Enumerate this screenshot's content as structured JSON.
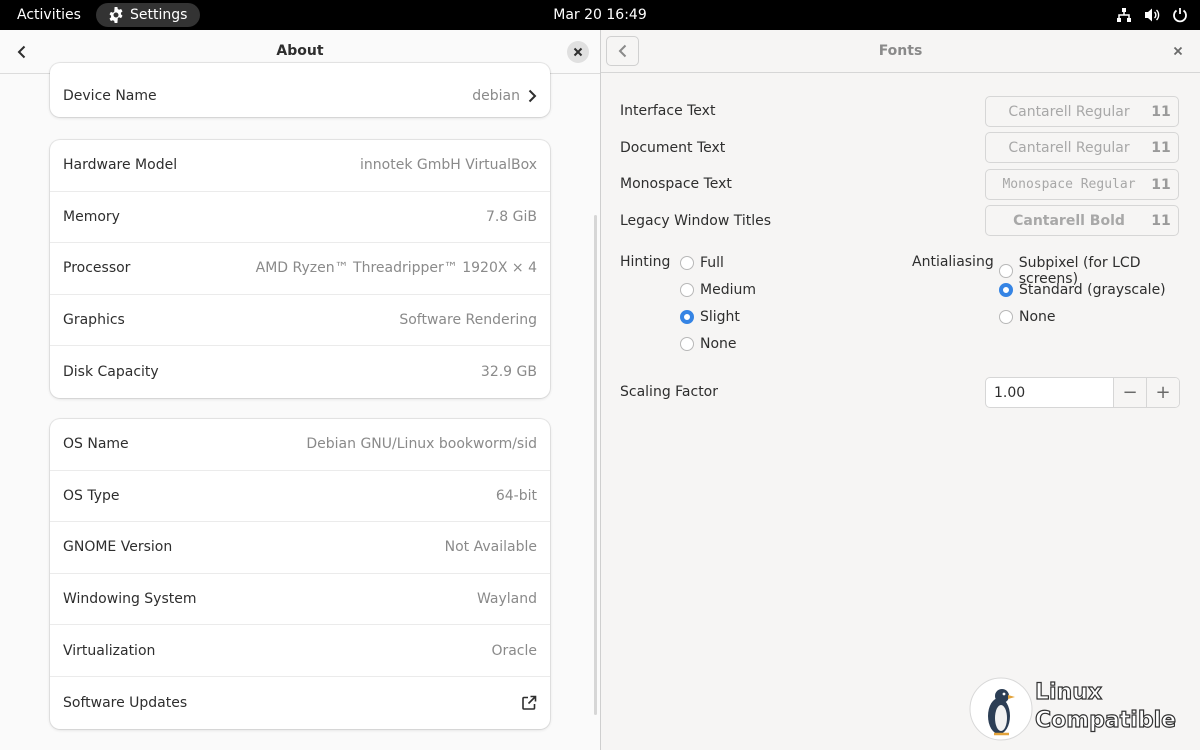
{
  "topbar": {
    "activities": "Activities",
    "app_name": "Settings",
    "clock": "Mar 20  16:49"
  },
  "about": {
    "title": "About",
    "device": {
      "label": "Device Name",
      "value": "debian"
    },
    "hardware": [
      {
        "label": "Hardware Model",
        "value": "innotek GmbH VirtualBox"
      },
      {
        "label": "Memory",
        "value": "7.8 GiB"
      },
      {
        "label": "Processor",
        "value": "AMD Ryzen™ Threadripper™ 1920X × 4"
      },
      {
        "label": "Graphics",
        "value": "Software Rendering"
      },
      {
        "label": "Disk Capacity",
        "value": "32.9 GB"
      }
    ],
    "os": [
      {
        "label": "OS Name",
        "value": "Debian GNU/Linux bookworm/sid"
      },
      {
        "label": "OS Type",
        "value": "64-bit"
      },
      {
        "label": "GNOME Version",
        "value": "Not Available"
      },
      {
        "label": "Windowing System",
        "value": "Wayland"
      },
      {
        "label": "Virtualization",
        "value": "Oracle"
      },
      {
        "label": "Software Updates",
        "value": ""
      }
    ]
  },
  "fonts": {
    "title": "Fonts",
    "interface_label": "Interface Text",
    "interface_font": "Cantarell Regular",
    "interface_size": "11",
    "document_label": "Document Text",
    "document_font": "Cantarell Regular",
    "document_size": "11",
    "monospace_label": "Monospace Text",
    "monospace_font": "Monospace Regular",
    "monospace_size": "11",
    "legacy_label": "Legacy Window Titles",
    "legacy_font": "Cantarell Bold",
    "legacy_size": "11",
    "hinting_label": "Hinting",
    "hinting_options": [
      "Full",
      "Medium",
      "Slight",
      "None"
    ],
    "hinting_selected": "Slight",
    "antialiasing_label": "Antialiasing",
    "antialiasing_options": [
      "Subpixel (for LCD screens)",
      "Standard (grayscale)",
      "None"
    ],
    "antialiasing_selected": "Standard (grayscale)",
    "scaling_label": "Scaling Factor",
    "scaling_value": "1.00",
    "minus": "−",
    "plus": "+"
  },
  "watermark": {
    "line1": "Linux",
    "line2": "Compatible"
  },
  "colors": {
    "accent": "#3584e4",
    "topbar": "#000000"
  }
}
